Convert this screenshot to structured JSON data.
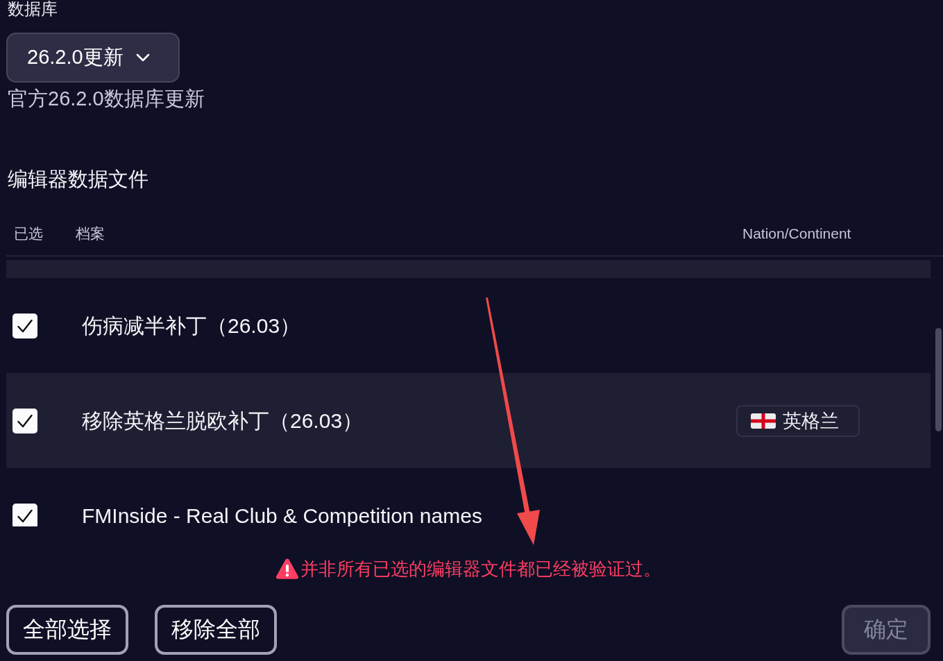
{
  "database": {
    "label": "数据库",
    "dropdown": {
      "value": "26.2.0更新"
    },
    "description": "官方26.2.0数据库更新"
  },
  "editor_files": {
    "title": "编辑器数据文件",
    "columns": [
      "已选",
      "档案",
      "Nation/Continent"
    ],
    "rows": [
      {
        "checked": true,
        "name": "伤病减半补丁（26.03）"
      },
      {
        "checked": true,
        "name": "移除英格兰脱欧补丁（26.03）",
        "nation": {
          "name": "英格兰"
        }
      },
      {
        "checked": true,
        "name": "FMInside - Real Club & Competition names"
      }
    ],
    "warning": "并非所有已选的编辑器文件都已经被验证过。"
  },
  "buttons": [
    {
      "label": "全部选择",
      "disabled": false
    },
    {
      "label": "移除全部",
      "disabled": false
    }
  ],
  "confirm_button": {
    "label": "确定",
    "disabled": true
  }
}
